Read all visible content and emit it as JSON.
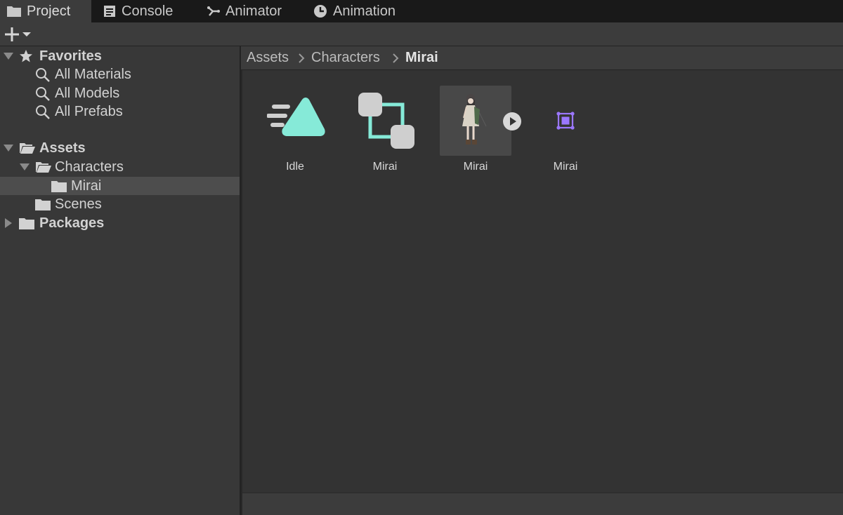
{
  "tabs": [
    {
      "label": "Project",
      "icon": "folder-icon"
    },
    {
      "label": "Console",
      "icon": "console-icon"
    },
    {
      "label": "Animator",
      "icon": "animator-icon"
    },
    {
      "label": "Animation",
      "icon": "animation-clock-icon"
    }
  ],
  "toolbar": {
    "create_icon": "plus-icon"
  },
  "tree": {
    "favorites": {
      "label": "Favorites",
      "items": [
        {
          "label": "All Materials"
        },
        {
          "label": "All Models"
        },
        {
          "label": "All Prefabs"
        }
      ]
    },
    "assets": {
      "label": "Assets",
      "characters": "Characters",
      "mirai": "Mirai",
      "scenes": "Scenes"
    },
    "packages": {
      "label": "Packages"
    }
  },
  "breadcrumb": [
    "Assets",
    "Characters",
    "Mirai"
  ],
  "assets": [
    {
      "name": "Idle",
      "icon": "animation-clip-icon"
    },
    {
      "name": "Mirai",
      "icon": "animator-controller-icon"
    },
    {
      "name": "Mirai",
      "icon": "character-model-thumbnail"
    },
    {
      "name": "Mirai",
      "icon": "avatar-icon"
    }
  ],
  "colors": {
    "accent_teal": "#86ead8",
    "avatar_purple": "#9b77ff",
    "panel": "#383838",
    "tab_bar": "#191919"
  }
}
